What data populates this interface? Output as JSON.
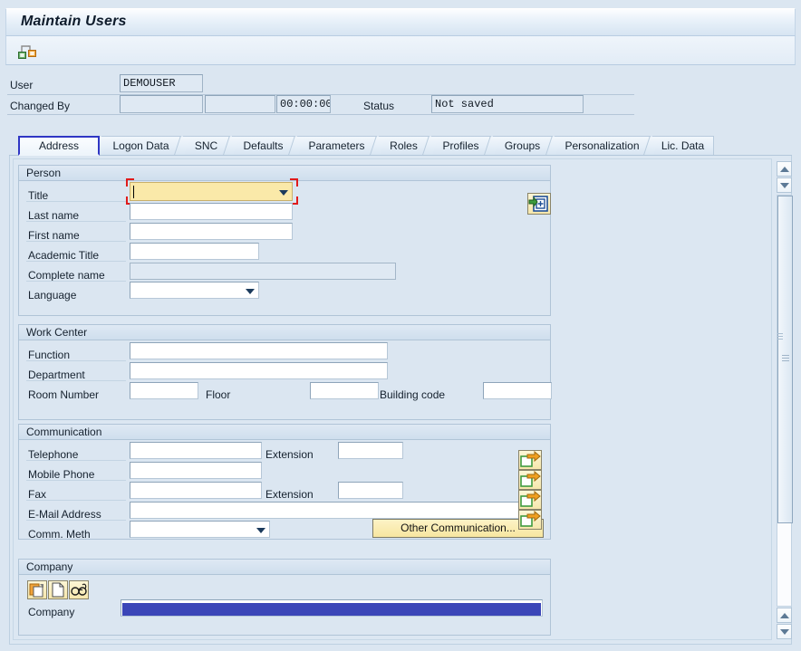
{
  "window": {
    "title": "Maintain Users"
  },
  "toolbar": {
    "icon_name": "relationship-icon"
  },
  "header": {
    "user_label": "User",
    "user_value": "DEMOUSER",
    "changed_by_label": "Changed By",
    "changed_by_value": "",
    "changed_date_value": "",
    "changed_time_value": "00:00:00",
    "status_label": "Status",
    "status_value": "Not saved"
  },
  "tabs": [
    {
      "label": "Address",
      "selected": true
    },
    {
      "label": "Logon Data",
      "selected": false
    },
    {
      "label": "SNC",
      "selected": false
    },
    {
      "label": "Defaults",
      "selected": false
    },
    {
      "label": "Parameters",
      "selected": false
    },
    {
      "label": "Roles",
      "selected": false
    },
    {
      "label": "Profiles",
      "selected": false
    },
    {
      "label": "Groups",
      "selected": false
    },
    {
      "label": "Personalization",
      "selected": false
    },
    {
      "label": "Lic. Data",
      "selected": false
    }
  ],
  "person": {
    "group_label": "Person",
    "title_label": "Title",
    "title_value": "",
    "last_name_label": "Last name",
    "last_name_value": "",
    "first_name_label": "First name",
    "first_name_value": "",
    "academic_title_label": "Academic Title",
    "academic_title_value": "",
    "complete_name_label": "Complete name",
    "complete_name_value": "",
    "language_label": "Language",
    "language_value": "",
    "address_button_name": "insert-address-icon"
  },
  "work_center": {
    "group_label": "Work Center",
    "function_label": "Function",
    "function_value": "",
    "department_label": "Department",
    "department_value": "",
    "room_number_label": "Room Number",
    "room_number_value": "",
    "floor_label": "Floor",
    "floor_value": "",
    "building_code_label": "Building code",
    "building_code_value": ""
  },
  "communication": {
    "group_label": "Communication",
    "telephone_label": "Telephone",
    "telephone_value": "",
    "telephone_ext_label": "Extension",
    "telephone_ext_value": "",
    "mobile_label": "Mobile Phone",
    "mobile_value": "",
    "fax_label": "Fax",
    "fax_value": "",
    "fax_ext_label": "Extension",
    "fax_ext_value": "",
    "email_label": "E-Mail Address",
    "email_value": "",
    "comm_meth_label": "Comm. Meth",
    "comm_meth_value": "",
    "other_button_label": "Other Communication...",
    "detail_button_name": "open-detail-icon"
  },
  "company": {
    "group_label": "Company",
    "company_label": "Company",
    "company_value": "",
    "buttons": [
      {
        "name": "copy-icon"
      },
      {
        "name": "new-document-icon"
      },
      {
        "name": "display-glasses-icon"
      }
    ]
  },
  "colors": {
    "accent": "#2f36c4",
    "focus_field": "#fae9a9",
    "focus_marker": "#e01b1b",
    "selection": "#3b46b8",
    "panel_bg": "#dce7f2",
    "button": "#f7e6a0"
  }
}
